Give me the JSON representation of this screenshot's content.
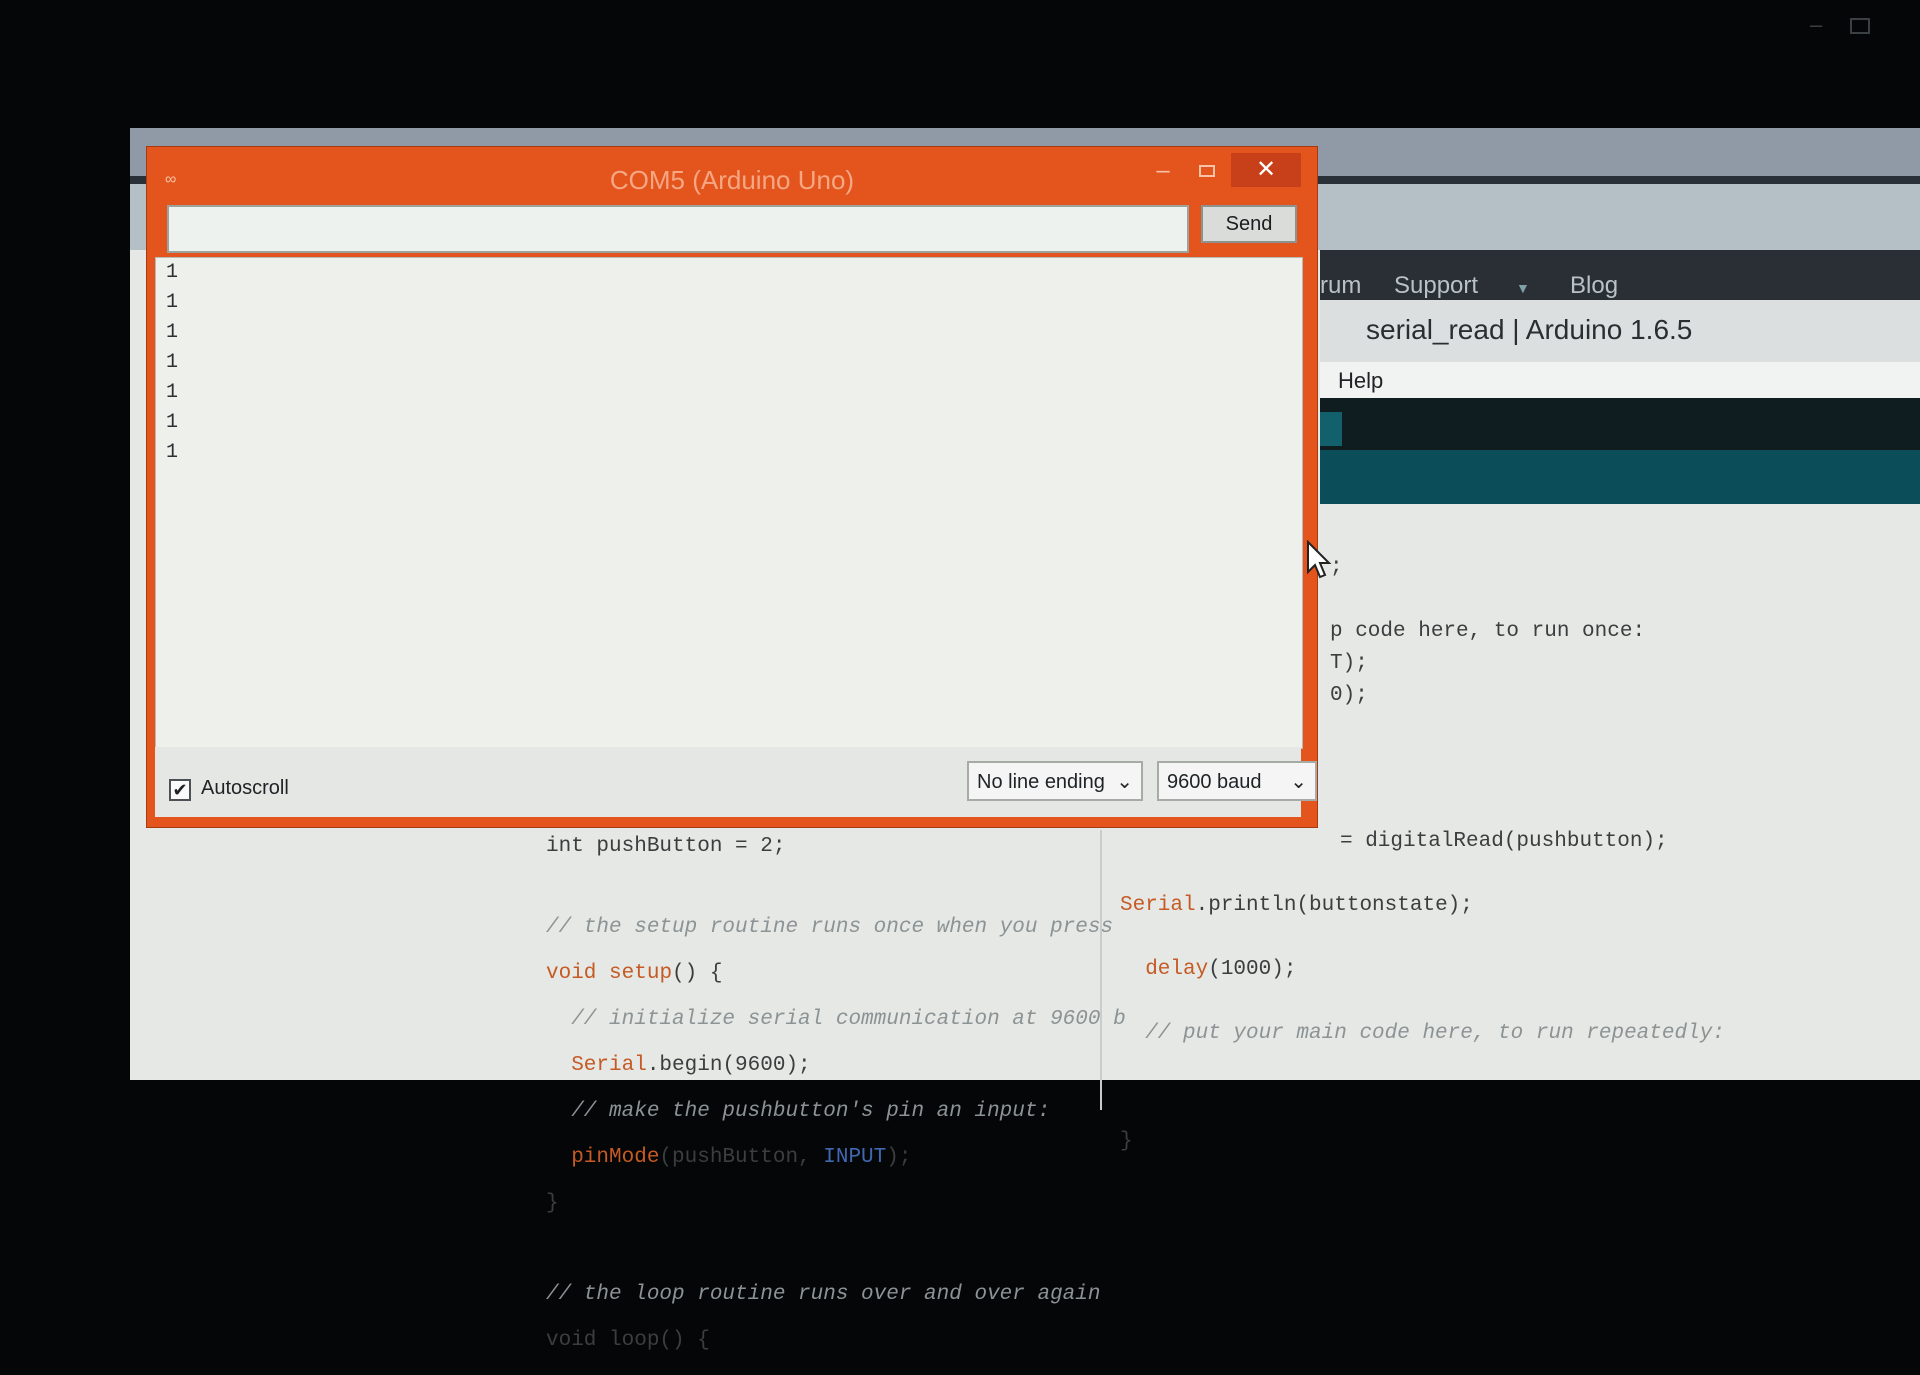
{
  "ide": {
    "nav_items": [
      "rum",
      "Support",
      "Blog"
    ],
    "title": "serial_read | Arduino 1.6.5",
    "menu": [
      "Help"
    ],
    "code_right_top": [
      ";",
      "",
      "p code here, to run once:",
      "T);",
      "0);"
    ],
    "code_left": {
      "line1": "int pushButton = 2;",
      "comment1": "// the setup routine runs once when you press",
      "setup_kw": "void",
      "setup_fn": "setup",
      "setup_tail": "() {",
      "comment2": "  // initialize serial communication at 9600 b",
      "begin_obj": "  Serial",
      "begin_tail": ".begin(9600);",
      "comment3": "  // make the pushbutton's pin an input:",
      "pinmode_fn": "  pinMode",
      "pinmode_args": "(pushButton, ",
      "pinmode_const": "INPUT",
      "pinmode_end": ");",
      "close": "}",
      "comment4": "// the loop routine runs over and over again",
      "loop_line": "void loop() {"
    },
    "code_right": {
      "read_line": "= digitalRead(pushbutton);",
      "println_obj": "Serial",
      "println_tail": ".println(buttonstate);",
      "delay_fn": "  delay",
      "delay_tail": "(1000);",
      "comment": "  // put your main code here, to run repeatedly:",
      "close": "}"
    }
  },
  "serial_monitor": {
    "title": "COM5 (Arduino Uno)",
    "send_label": "Send",
    "input_value": "",
    "output_lines": [
      "1",
      "1",
      "1",
      "1",
      "1",
      "1",
      "1"
    ],
    "autoscroll_label": "Autoscroll",
    "autoscroll_checked": true,
    "line_ending": "No line ending",
    "baud": "9600 baud"
  },
  "colors": {
    "window_accent": "#e3551d",
    "ide_toolbar": "#0f1d20",
    "ide_tab": "#0c4d5a"
  },
  "icons": [
    "arduino-logo-icon",
    "minimize-icon",
    "maximize-icon",
    "close-icon",
    "check-icon",
    "chevron-down-icon",
    "mouse-cursor-icon"
  ]
}
